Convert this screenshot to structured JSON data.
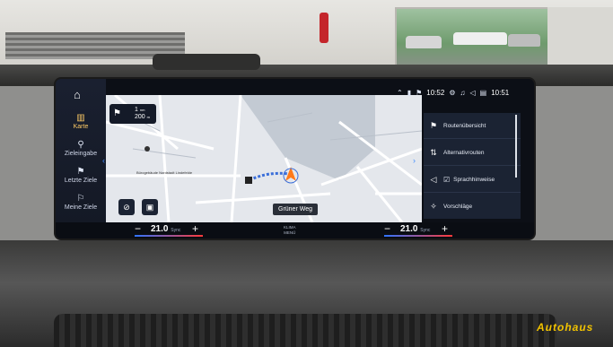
{
  "status": {
    "time_left": "10:52",
    "time_right": "10:51"
  },
  "sidebar": {
    "items": [
      {
        "label": "Karte",
        "icon": "map-icon"
      },
      {
        "label": "Zieleingabe",
        "icon": "search-icon"
      },
      {
        "label": "Letzte Ziele",
        "icon": "recent-destinations-icon"
      },
      {
        "label": "Meine Ziele",
        "icon": "my-destinations-icon"
      }
    ]
  },
  "turn_card": {
    "dist_top": "1",
    "dist_top_unit": "nm",
    "dist_bottom": "200",
    "dist_bottom_unit": "m"
  },
  "map": {
    "street_name": "Grüner Weg",
    "poi_label": "Bürogebäude Nordstadt Lindefelde"
  },
  "right_panel": {
    "items": [
      {
        "label": "Routenübersicht",
        "icon": "route-overview-icon"
      },
      {
        "label": "Alternativrouten",
        "icon": "alternative-routes-icon"
      },
      {
        "label": "Sprachhinweise",
        "icon": "voice-guidance-icon"
      },
      {
        "label": "Vorschläge",
        "icon": "suggestions-icon"
      }
    ]
  },
  "climate": {
    "left_temp": "21.0",
    "left_unit": "Sync",
    "right_temp": "21.0",
    "right_unit": "Sync",
    "minus": "−",
    "plus": "+",
    "klima_label_1": "KLIMA",
    "klima_label_2": "MENÜ"
  },
  "watermark": "Autohaus"
}
